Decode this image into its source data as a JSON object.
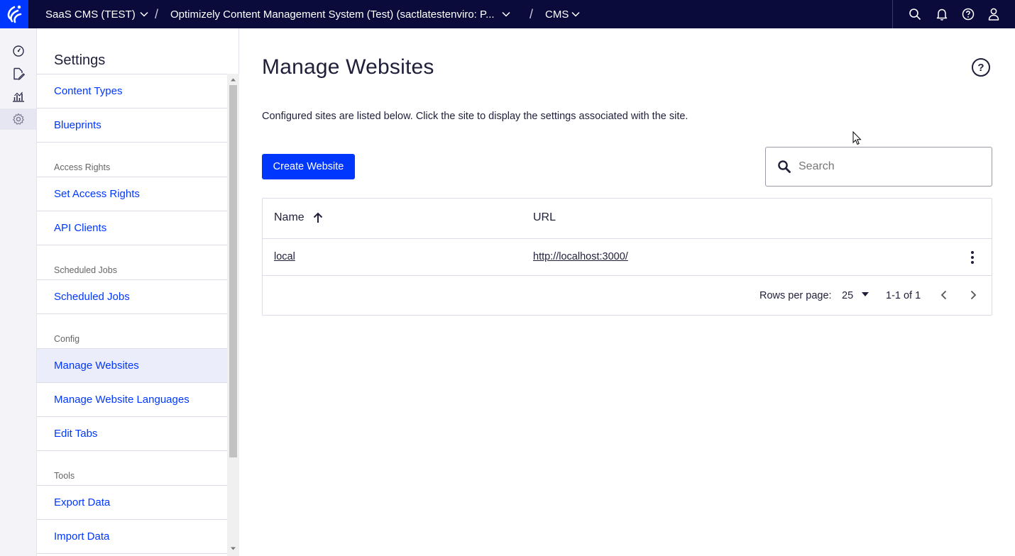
{
  "topbar": {
    "product": "SaaS CMS (TEST)",
    "environment": "Optimizely Content Management System (Test) (sactlatestenviro: P...",
    "app": "CMS",
    "background": "#0b0b3b",
    "logo_color": "#0037ff"
  },
  "rail": {
    "items": [
      "dashboard-icon",
      "edit-icon",
      "analytics-icon",
      "settings-icon"
    ],
    "active": "settings-icon"
  },
  "settings": {
    "title": "Settings",
    "items": [
      {
        "type": "link",
        "label": "Content Types"
      },
      {
        "type": "link",
        "label": "Blueprints"
      },
      {
        "type": "group",
        "label": "Access Rights"
      },
      {
        "type": "link",
        "label": "Set Access Rights"
      },
      {
        "type": "link",
        "label": "API Clients"
      },
      {
        "type": "group",
        "label": "Scheduled Jobs"
      },
      {
        "type": "link",
        "label": "Scheduled Jobs"
      },
      {
        "type": "group",
        "label": "Config"
      },
      {
        "type": "link",
        "label": "Manage Websites",
        "active": true
      },
      {
        "type": "link",
        "label": "Manage Website Languages"
      },
      {
        "type": "link",
        "label": "Edit Tabs"
      },
      {
        "type": "group",
        "label": "Tools"
      },
      {
        "type": "link",
        "label": "Export Data"
      },
      {
        "type": "link",
        "label": "Import Data"
      }
    ]
  },
  "main": {
    "title": "Manage Websites",
    "help_label": "?",
    "description": "Configured sites are listed below. Click the site to display the settings associated with the site.",
    "create_button": "Create Website",
    "search_placeholder": "Search",
    "accent": "#0037ff",
    "table": {
      "columns": [
        "Name",
        "URL"
      ],
      "sort": {
        "column": "Name",
        "direction": "ascending"
      },
      "rows": [
        {
          "name": "local",
          "url": "http://localhost:3000/"
        }
      ],
      "footer": {
        "rows_per_page_label": "Rows per page:",
        "rows_per_page": "25",
        "range": "1-1 of 1"
      }
    }
  }
}
